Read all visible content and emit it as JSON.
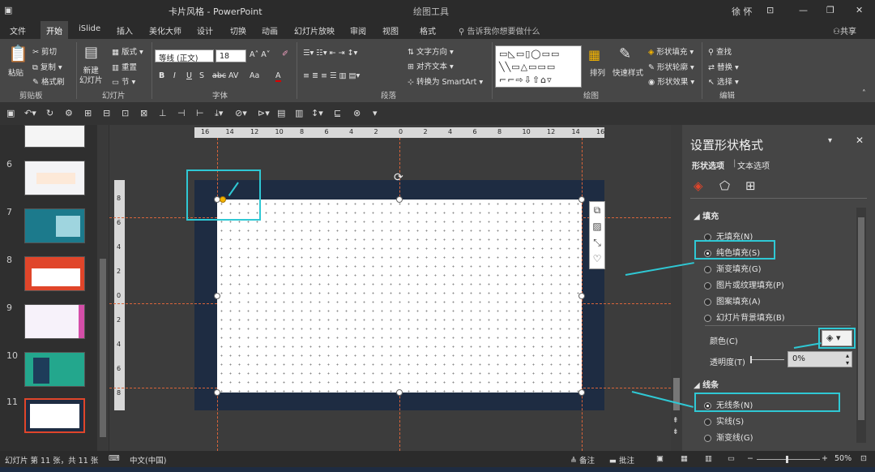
{
  "titlebar": {
    "doc_title": "卡片风格 - PowerPoint",
    "tool_context": "绘图工具",
    "user": "徐 怀"
  },
  "tabs": [
    "文件",
    "开始",
    "iSlide",
    "插入",
    "美化大师",
    "设计",
    "切换",
    "动画",
    "幻灯片放映",
    "审阅",
    "视图",
    "格式"
  ],
  "active_tab": "开始",
  "search_placeholder": "告诉我你想要做什么",
  "share_label": "共享",
  "ribbon": {
    "clipboard": {
      "paste": "粘贴",
      "cut": "剪切",
      "copy": "复制",
      "format_painter": "格式刷",
      "group": "剪贴板"
    },
    "slides": {
      "new_slide": "新建\n幻灯片",
      "layout": "版式",
      "reset": "重置",
      "section": "节",
      "group": "幻灯片"
    },
    "font": {
      "font_name": "等线 (正文)",
      "font_size": "18",
      "group": "字体",
      "bold": "B",
      "italic": "I",
      "underline": "U",
      "shadow": "S",
      "strike": "abc",
      "spacing": "AV",
      "case": "Aa",
      "color": "A"
    },
    "paragraph": {
      "text_direction": "文字方向",
      "align_text": "对齐文本",
      "smartart": "转换为 SmartArt",
      "group": "段落"
    },
    "drawing": {
      "arrange": "排列",
      "quick_styles": "快速样式",
      "shape_fill": "形状填充",
      "shape_outline": "形状轮廓",
      "shape_effects": "形状效果",
      "group": "绘图"
    },
    "editing": {
      "find": "查找",
      "replace": "替换",
      "select": "选择",
      "group": "编辑"
    }
  },
  "thumbnails": [
    {
      "num": "6"
    },
    {
      "num": "7"
    },
    {
      "num": "8"
    },
    {
      "num": "9"
    },
    {
      "num": "10"
    },
    {
      "num": "11"
    }
  ],
  "ruler": {
    "h_ticks": [
      "16",
      "14",
      "12",
      "10",
      "8",
      "6",
      "4",
      "2",
      "0",
      "2",
      "4",
      "6",
      "8",
      "10",
      "12",
      "14",
      "16"
    ],
    "v_ticks": [
      "8",
      "6",
      "4",
      "2",
      "0",
      "2",
      "4",
      "6",
      "8"
    ]
  },
  "format_pane": {
    "title": "设置形状格式",
    "tab_shape": "形状选项",
    "tab_text": "文本选项",
    "fill_section": "填充",
    "fill_options": [
      {
        "label": "无填充(N)",
        "on": false
      },
      {
        "label": "纯色填充(S)",
        "on": true
      },
      {
        "label": "渐变填充(G)",
        "on": false
      },
      {
        "label": "图片或纹理填充(P)",
        "on": false
      },
      {
        "label": "图案填充(A)",
        "on": false
      },
      {
        "label": "幻灯片背景填充(B)",
        "on": false
      }
    ],
    "color_label": "颜色(C)",
    "transparency_label": "透明度(T)",
    "transparency_value": "0%",
    "line_section": "线条",
    "line_options": [
      {
        "label": "无线条(N)",
        "on": true
      },
      {
        "label": "实线(S)",
        "on": false
      },
      {
        "label": "渐变线(G)",
        "on": false
      }
    ]
  },
  "status": {
    "slide_info": "幻灯片 第 11 张，共 11 张",
    "language": "中文(中国)",
    "notes": "备注",
    "comments": "批注",
    "zoom": "50%"
  },
  "colors": {
    "accent": "#2fc8d4",
    "guide": "#d9643a",
    "slide_bg": "#1e2c42"
  }
}
